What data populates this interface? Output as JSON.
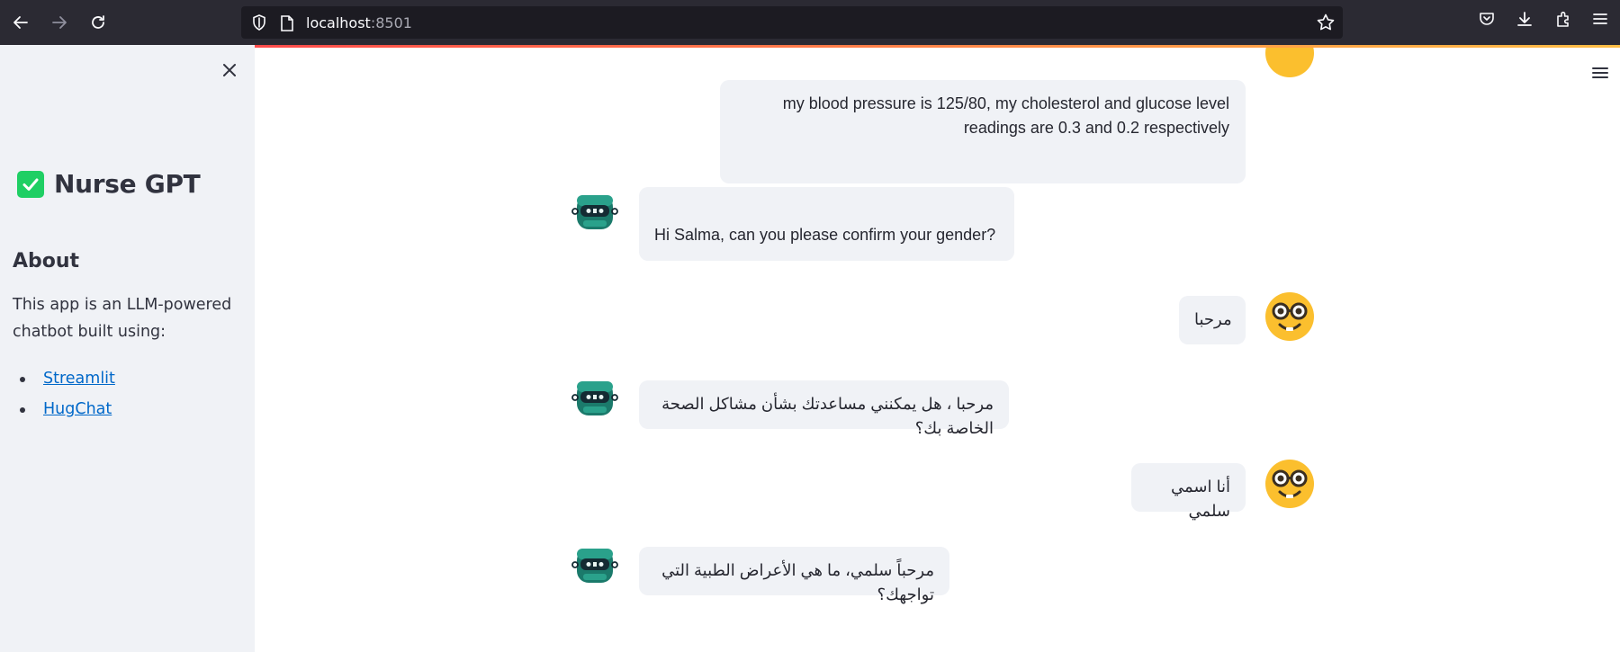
{
  "browser": {
    "url_host": "localhost",
    "url_port": ":8501"
  },
  "sidebar": {
    "title": "Nurse GPT",
    "about_heading": "About",
    "about_text": "This app is an LLM-powered chatbot built using:",
    "links": [
      {
        "label": "Streamlit"
      },
      {
        "label": "HugChat"
      }
    ]
  },
  "chat": {
    "messages": [
      {
        "role": "user",
        "text": "my blood pressure is 125/80, my cholesterol and glucose level readings are 0.3 and 0.2 respectively"
      },
      {
        "role": "assistant",
        "text": "Hi Salma, can you please confirm your gender?"
      },
      {
        "role": "user",
        "text": "مرحبا"
      },
      {
        "role": "assistant",
        "text": "مرحبا ، هل يمكنني مساعدتك بشأن مشاكل الصحة الخاصة بك؟"
      },
      {
        "role": "user",
        "text": "أنا اسمي سلمي"
      },
      {
        "role": "assistant",
        "text": "مرحباً سلمي، ما هي الأعراض الطبية التي تواجهك؟"
      }
    ]
  },
  "colors": {
    "browser_bg": "#2b2a33",
    "sidebar_bg": "#f0f2f6",
    "bubble_bg": "#f0f2f6",
    "brand_check": "#1fcf64",
    "link": "#0068c9",
    "user_avatar": "#fbbf2e",
    "bot_avatar": "#1b7a6b"
  },
  "icons": {
    "user_avatar": "nerd-face-icon",
    "bot_avatar": "robot-icon"
  }
}
